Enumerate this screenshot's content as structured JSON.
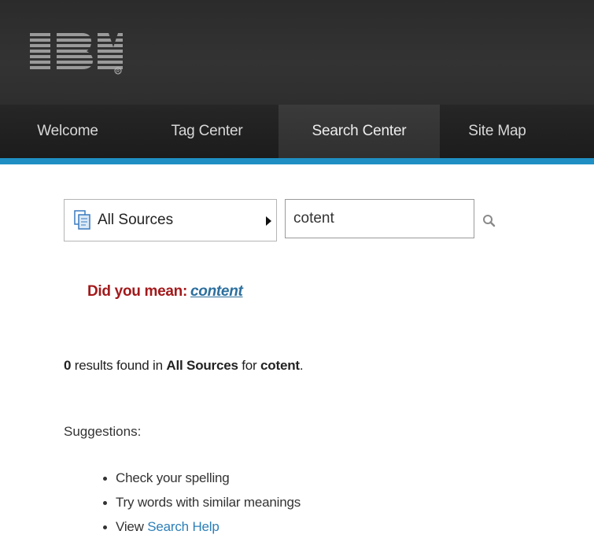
{
  "branding": {
    "logo_text": "IBM",
    "registered_mark": "®"
  },
  "nav": {
    "items": [
      {
        "label": "Welcome"
      },
      {
        "label": "Tag Center"
      },
      {
        "label": "Search Center",
        "active": true
      },
      {
        "label": "Site Map"
      }
    ]
  },
  "colors": {
    "accent": "#1f8fc3",
    "did_you_mean": "#a3191b",
    "link": "#2c7fb8"
  },
  "search": {
    "source": "All Sources",
    "query": "cotent",
    "source_icon": "documents-icon",
    "submit_icon": "search-icon"
  },
  "spelling": {
    "prompt": "Did you mean:",
    "suggestion": "content"
  },
  "results": {
    "count": "0",
    "text_found": " results found in ",
    "scope": "All Sources",
    "text_for": " for ",
    "query": "cotent",
    "period": "."
  },
  "suggestions": {
    "label": "Suggestions:",
    "items": [
      "Check your spelling",
      "Try words with similar meanings"
    ],
    "view_prefix": "View ",
    "help_link": "Search Help"
  }
}
